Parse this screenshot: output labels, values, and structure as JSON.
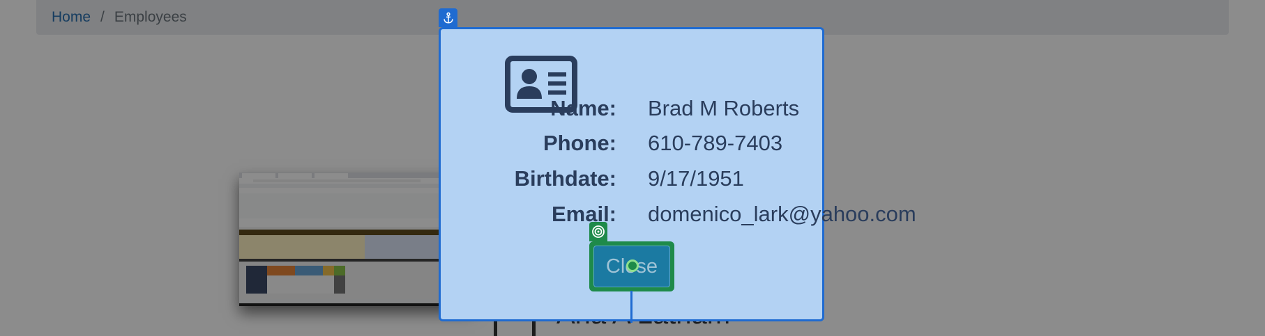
{
  "breadcrumb": {
    "home": "Home",
    "separator": "/",
    "current": "Employees"
  },
  "behind_card": {
    "partial_name": "Aria A Latham"
  },
  "modal": {
    "fields": [
      {
        "label": "Name:",
        "value": "Brad M Roberts"
      },
      {
        "label": "Phone:",
        "value": "610-789-7403"
      },
      {
        "label": "Birthdate:",
        "value": "9/17/1951"
      },
      {
        "label": "Email:",
        "value": "domenico_lark@yahoo.com"
      }
    ],
    "close_label": "Close"
  },
  "icons": {
    "contact": "contact-card-icon",
    "anchor": "anchor-icon",
    "target": "target-icon"
  },
  "colors": {
    "highlight_fill": "#b3d2f3",
    "highlight_border": "#1f6bd1",
    "target_border": "#1e8a4a",
    "button_fill": "#1b7aa2",
    "text": "#2a3d5c"
  }
}
